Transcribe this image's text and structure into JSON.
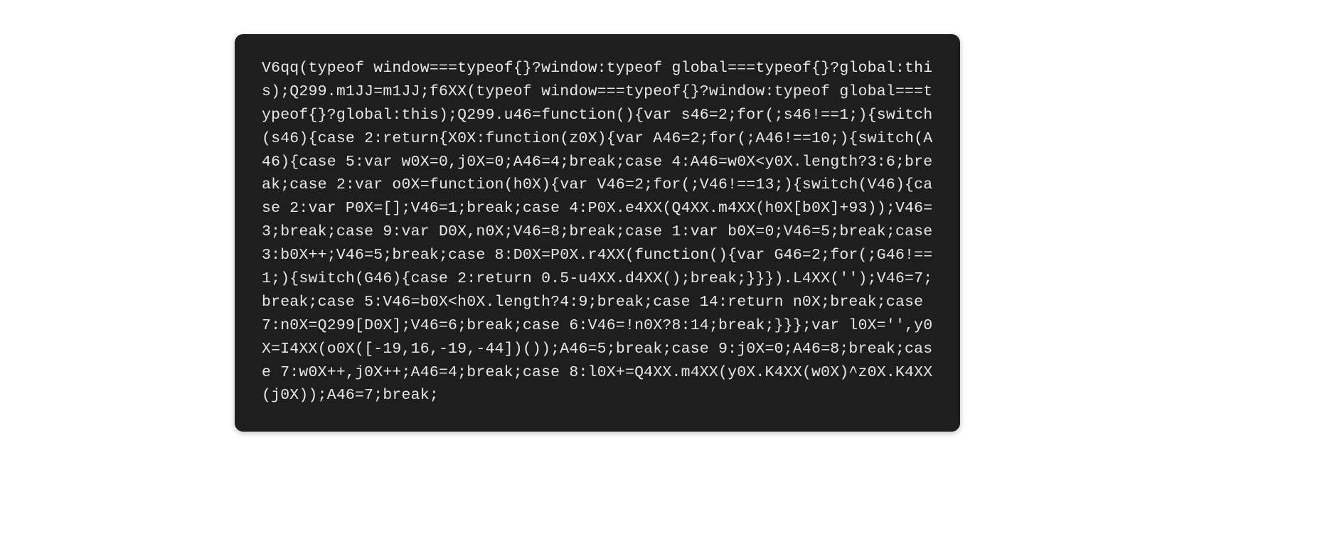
{
  "code": {
    "content": "V6qq(typeof window===typeof{}?window:typeof global===typeof{}?global:this);Q299.m1JJ=m1JJ;f6XX(typeof window===typeof{}?window:typeof global===typeof{}?global:this);Q299.u46=function(){var s46=2;for(;s46!==1;){switch(s46){case 2:return{X0X:function(z0X){var A46=2;for(;A46!==10;){switch(A46){case 5:var w0X=0,j0X=0;A46=4;break;case 4:A46=w0X<y0X.length?3:6;break;case 2:var o0X=function(h0X){var V46=2;for(;V46!==13;){switch(V46){case 2:var P0X=[];V46=1;break;case 4:P0X.e4XX(Q4XX.m4XX(h0X[b0X]+93));V46=3;break;case 9:var D0X,n0X;V46=8;break;case 1:var b0X=0;V46=5;break;case 3:b0X++;V46=5;break;case 8:D0X=P0X.r4XX(function(){var G46=2;for(;G46!==1;){switch(G46){case 2:return 0.5-u4XX.d4XX();break;}}}).L4XX('');V46=7;break;case 5:V46=b0X<h0X.length?4:9;break;case 14:return n0X;break;case 7:n0X=Q299[D0X];V46=6;break;case 6:V46=!n0X?8:14;break;}}};var l0X='',y0X=I4XX(o0X([-19,16,-19,-44])());A46=5;break;case 9:j0X=0;A46=8;break;case 7:w0X++,j0X++;A46=4;break;case 8:l0X+=Q4XX.m4XX(y0X.K4XX(w0X)^z0X.K4XX(j0X));A46=7;break;"
  }
}
